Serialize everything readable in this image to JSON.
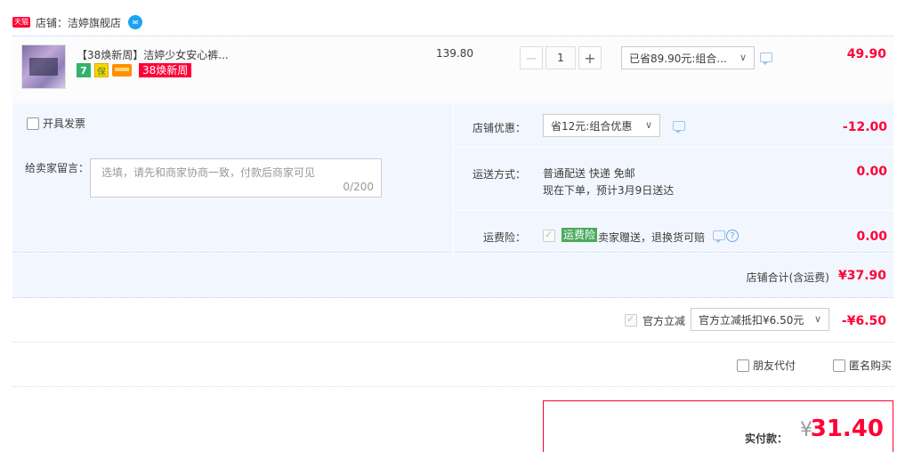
{
  "shop": {
    "badge": "天猫",
    "label": "店铺：洁婷旗舰店"
  },
  "item": {
    "title": "【38焕新周】洁婷少女安心裤...",
    "tag_seven": "7",
    "tag_cert": "保",
    "promo_tag": "38焕新周",
    "unit_price": "139.80",
    "quantity": "1",
    "minus": "−",
    "plus": "+",
    "discount_select": "已省89.90元:组合...",
    "subtotal": "49.90"
  },
  "invoice": {
    "label": "开具发票"
  },
  "message": {
    "label": "给卖家留言：",
    "placeholder": "选填，请先和商家协商一致，付款后商家可见",
    "count": "0/200"
  },
  "shop_coupon": {
    "label": "店铺优惠：",
    "select": "省12元:组合优惠",
    "value": "-12.00"
  },
  "shipping": {
    "label": "运送方式：",
    "line1": "普通配送 快递 免邮",
    "line2": "现在下单，预计3月9日送达",
    "value": "0.00"
  },
  "insurance": {
    "label": "运费险：",
    "badge": "运费险",
    "text": "卖家赠送，退换货可赔",
    "help": "?",
    "value": "0.00"
  },
  "shop_total": {
    "label": "店铺合计(含运费)",
    "value": "¥37.90"
  },
  "official": {
    "label": "官方立减",
    "select": "官方立减抵扣¥6.50元",
    "value": "-¥6.50"
  },
  "extras": {
    "friend_pay": "朋友代付",
    "anonymous": "匿名购买"
  },
  "payment": {
    "label": "实付款：",
    "currency": "¥",
    "amount": "31.40"
  },
  "colors": {
    "accent": "#ff0036",
    "panel": "#f2f7ff",
    "badge_green": "#4aa95c"
  }
}
